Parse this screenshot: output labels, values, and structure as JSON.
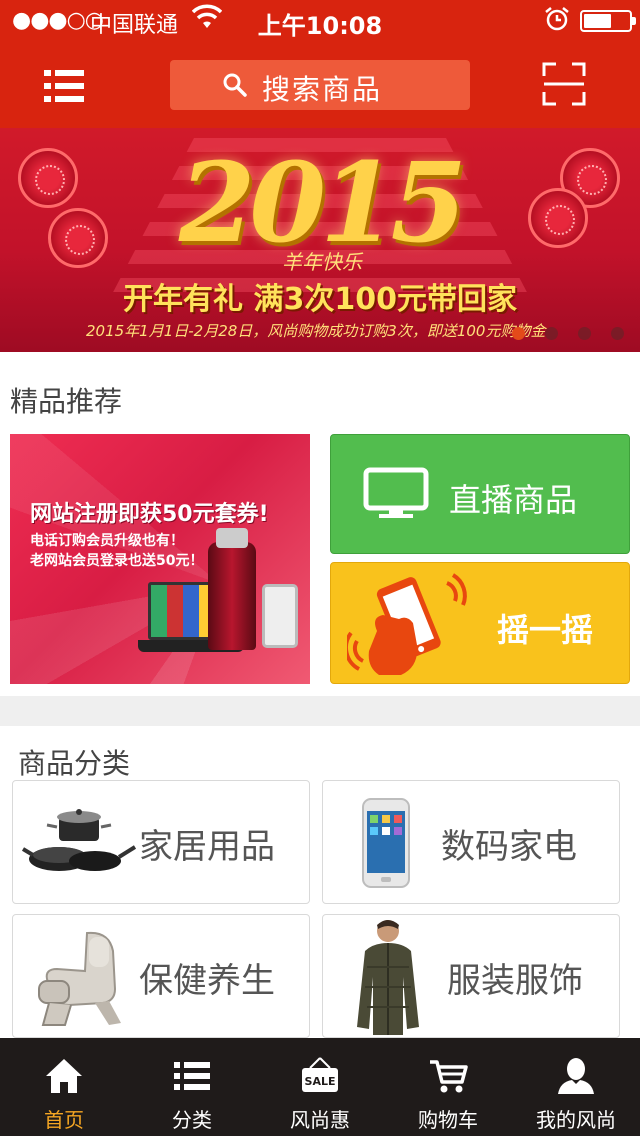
{
  "status_bar": {
    "signal": "●●●○○",
    "carrier": "中国联通",
    "time": "上午10:08",
    "wifi_icon": "wifi-icon",
    "alarm_icon": "alarm-icon",
    "battery_level": 0.62
  },
  "header": {
    "menu_icon": "list-icon",
    "search_placeholder": "搜索商品",
    "scan_icon": "scan-icon",
    "bg_color": "#d8240f"
  },
  "banner": {
    "year": "2015",
    "tag": "羊年快乐",
    "headline": "开年有礼 满3次100元带回家",
    "subline": "2015年1月1日-2月28日，风尚购物成功订购3次，即送100元购物金",
    "slide_count": 4,
    "active_slide": 1
  },
  "featured": {
    "title": "精品推荐",
    "promo": {
      "headline": "网站注册即获50元套券!",
      "line1": "电话订购会员升级也有！",
      "line2": "老网站会员登录也送50元！"
    },
    "live_label": "直播商品",
    "shake_label": "摇一摇",
    "live_color": "#52bd4e",
    "shake_color": "#f9c21c"
  },
  "categories": {
    "title": "商品分类",
    "items": [
      {
        "label": "家居用品",
        "icon": "cookware-icon"
      },
      {
        "label": "数码家电",
        "icon": "smartphone-icon"
      },
      {
        "label": "保健养生",
        "icon": "massage-chair-icon"
      },
      {
        "label": "服装服饰",
        "icon": "apparel-icon"
      }
    ]
  },
  "tabbar": {
    "items": [
      {
        "label": "首页",
        "icon": "home-icon",
        "active": true
      },
      {
        "label": "分类",
        "icon": "list-icon"
      },
      {
        "label": "风尚惠",
        "icon": "sale-tag-icon",
        "badge": "SALE"
      },
      {
        "label": "购物车",
        "icon": "cart-icon"
      },
      {
        "label": "我的风尚",
        "icon": "user-icon"
      }
    ],
    "active_color": "#f5a623"
  }
}
